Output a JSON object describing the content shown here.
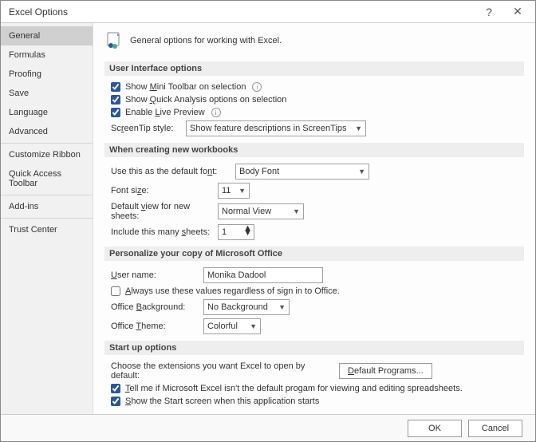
{
  "titlebar": {
    "title": "Excel Options"
  },
  "sidebar": {
    "items": [
      {
        "label": "General",
        "sel": true
      },
      {
        "label": "Formulas"
      },
      {
        "label": "Proofing"
      },
      {
        "label": "Save"
      },
      {
        "label": "Language"
      },
      {
        "label": "Advanced"
      },
      {
        "sep": true
      },
      {
        "label": "Customize Ribbon"
      },
      {
        "label": "Quick Access Toolbar"
      },
      {
        "sep": true
      },
      {
        "label": "Add-ins"
      },
      {
        "sep": true
      },
      {
        "label": "Trust Center"
      }
    ]
  },
  "header": {
    "text": "General options for working with Excel."
  },
  "sections": {
    "ui": {
      "title": "User Interface options",
      "chk_mini": "Show Mini Toolbar on selection",
      "chk_quick": "Show Quick Analysis options on selection",
      "chk_live": "Enable Live Preview",
      "st_label": "ScreenTip style:",
      "st_value": "Show feature descriptions in ScreenTips"
    },
    "wb": {
      "title": "When creating new workbooks",
      "font_label": "Use this as the default font:",
      "font_value": "Body Font",
      "size_label": "Font size:",
      "size_value": "11",
      "view_label": "Default view for new sheets:",
      "view_value": "Normal View",
      "sheets_label": "Include this many sheets:",
      "sheets_value": "1"
    },
    "pers": {
      "title": "Personalize your copy of Microsoft Office",
      "user_label": "User name:",
      "user_value": "Monika Dadool",
      "chk_always": "Always use these values regardless of sign in to Office.",
      "bg_label": "Office Background:",
      "bg_value": "No Background",
      "theme_label": "Office Theme:",
      "theme_value": "Colorful"
    },
    "start": {
      "title": "Start up options",
      "ext_label": "Choose the extensions you want Excel to open by default:",
      "ext_btn": "Default Programs...",
      "chk_tell": "Tell me if Microsoft Excel isn't the default progam for viewing and editing spreadsheets.",
      "chk_start": "Show the Start screen when this application starts"
    }
  },
  "footer": {
    "ok": "OK",
    "cancel": "Cancel"
  }
}
